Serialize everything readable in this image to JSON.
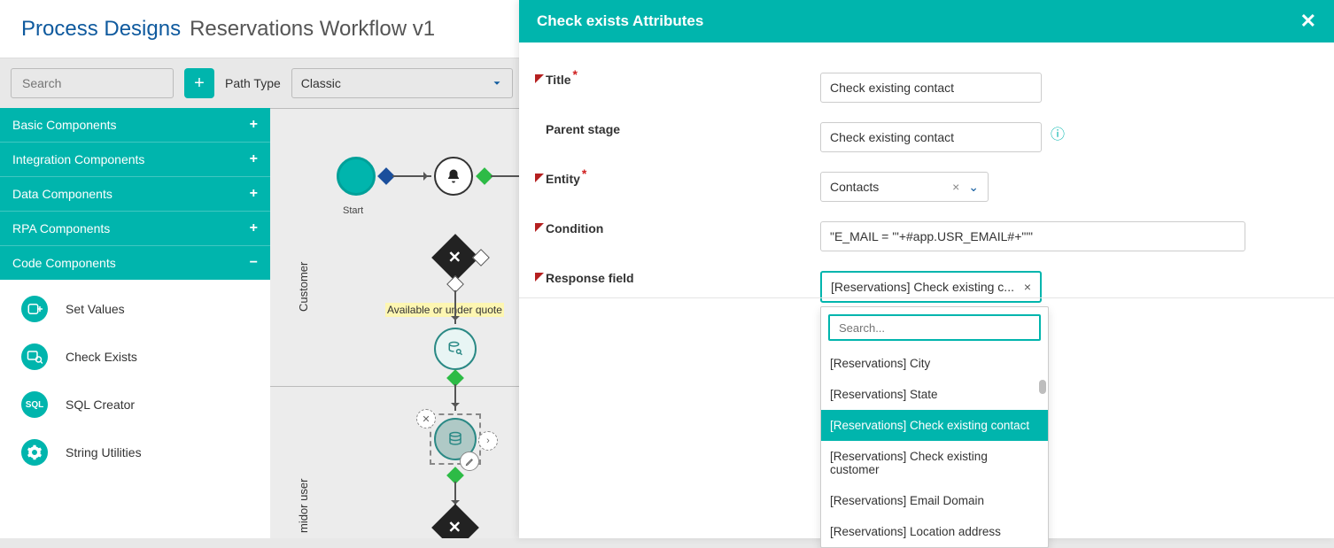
{
  "breadcrumb": {
    "root": "Process Designs",
    "current": "Reservations Workflow v1"
  },
  "toolbar": {
    "search_placeholder": "Search",
    "path_type_label": "Path Type",
    "path_type_value": "Classic"
  },
  "sidebar": {
    "categories": [
      {
        "label": "Basic Components",
        "expand": "+"
      },
      {
        "label": "Integration Components",
        "expand": "+"
      },
      {
        "label": "Data Components",
        "expand": "+"
      },
      {
        "label": "RPA Components",
        "expand": "+"
      },
      {
        "label": "Code Components",
        "expand": "−"
      }
    ],
    "components": [
      {
        "label": "Set Values"
      },
      {
        "label": "Check Exists"
      },
      {
        "label": "SQL Creator"
      },
      {
        "label": "String Utilities"
      }
    ]
  },
  "canvas": {
    "start_label": "Start",
    "lane1": "Customer",
    "lane2": "midor user",
    "gateway_label": "Available or under quote"
  },
  "panel": {
    "title": "Check exists Attributes",
    "labels": {
      "title": "Title",
      "parent": "Parent stage",
      "entity": "Entity",
      "condition": "Condition",
      "response": "Response field"
    },
    "values": {
      "title": "Check existing contact",
      "parent": "Check existing contact",
      "entity": "Contacts",
      "condition": "\"E_MAIL = '\"+#app.USR_EMAIL#+\"'\"",
      "response": "[Reservations] Check existing c..."
    },
    "dropdown": {
      "search_placeholder": "Search...",
      "items": [
        "[Reservations] City",
        "[Reservations] State",
        "[Reservations] Check existing contact",
        "[Reservations] Check existing customer",
        "[Reservations] Email Domain",
        "[Reservations] Location address"
      ],
      "selected_index": 2
    }
  }
}
